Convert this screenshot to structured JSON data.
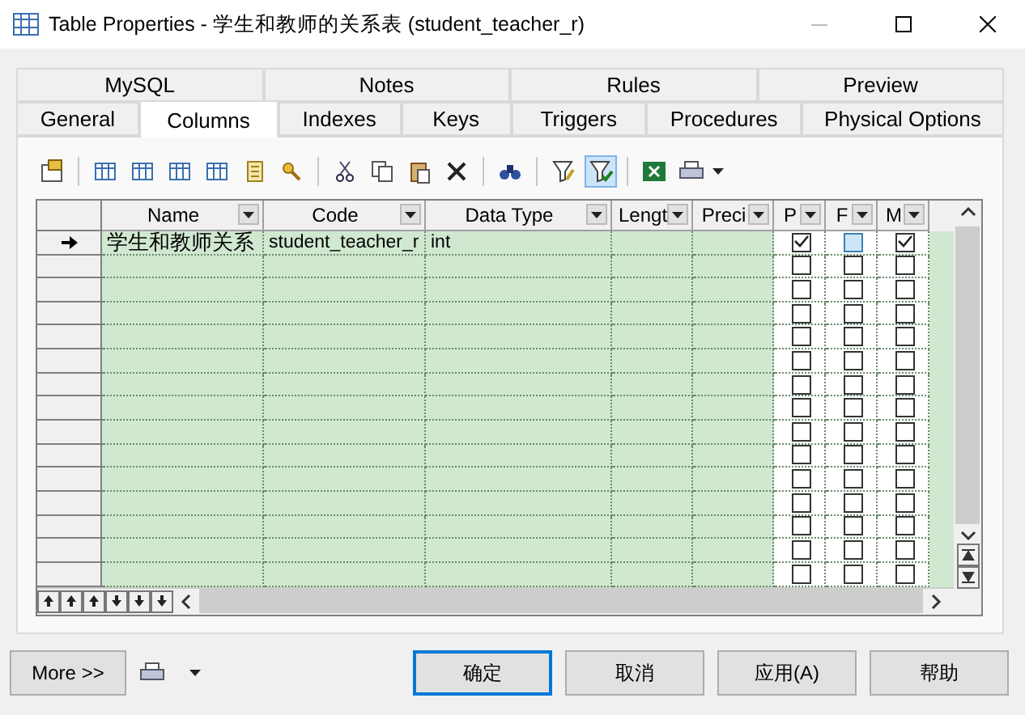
{
  "window": {
    "title": "Table Properties - 学生和教师的关系表 (student_teacher_r)"
  },
  "tab_rows": [
    [
      {
        "label": "MySQL",
        "selected": false
      },
      {
        "label": "Notes",
        "selected": false
      },
      {
        "label": "Rules",
        "selected": false
      },
      {
        "label": "Preview",
        "selected": false
      }
    ],
    [
      {
        "label": "General",
        "selected": false
      },
      {
        "label": "Columns",
        "selected": true
      },
      {
        "label": "Indexes",
        "selected": false
      },
      {
        "label": "Keys",
        "selected": false
      },
      {
        "label": "Triggers",
        "selected": false
      },
      {
        "label": "Procedures",
        "selected": false
      },
      {
        "label": "Physical Options",
        "selected": false
      }
    ]
  ],
  "toolbar": {
    "filter_pressed": true
  },
  "table": {
    "columns": [
      "Name",
      "Code",
      "Data Type",
      "Lengt",
      "Preci",
      "P",
      "F",
      "M"
    ],
    "rows": [
      {
        "current": true,
        "name": "学生和教师关系",
        "code": "student_teacher_r",
        "data_type": "int",
        "checks": [
          {
            "checked": true,
            "focused": false
          },
          {
            "checked": false,
            "focused": true
          },
          {
            "checked": true,
            "focused": false
          }
        ]
      },
      {
        "current": false,
        "checks": [
          {
            "checked": false,
            "focused": false
          },
          {
            "checked": false,
            "focused": false
          },
          {
            "checked": false,
            "focused": false
          }
        ]
      },
      {
        "current": false,
        "checks": [
          {
            "checked": false,
            "focused": false
          },
          {
            "checked": false,
            "focused": false
          },
          {
            "checked": false,
            "focused": false
          }
        ]
      },
      {
        "current": false,
        "checks": [
          {
            "checked": false,
            "focused": false
          },
          {
            "checked": false,
            "focused": false
          },
          {
            "checked": false,
            "focused": false
          }
        ]
      },
      {
        "current": false,
        "checks": [
          {
            "checked": false,
            "focused": false
          },
          {
            "checked": false,
            "focused": false
          },
          {
            "checked": false,
            "focused": false
          }
        ]
      },
      {
        "current": false,
        "checks": [
          {
            "checked": false,
            "focused": false
          },
          {
            "checked": false,
            "focused": false
          },
          {
            "checked": false,
            "focused": false
          }
        ]
      },
      {
        "current": false,
        "checks": [
          {
            "checked": false,
            "focused": false
          },
          {
            "checked": false,
            "focused": false
          },
          {
            "checked": false,
            "focused": false
          }
        ]
      },
      {
        "current": false,
        "checks": [
          {
            "checked": false,
            "focused": false
          },
          {
            "checked": false,
            "focused": false
          },
          {
            "checked": false,
            "focused": false
          }
        ]
      },
      {
        "current": false,
        "checks": [
          {
            "checked": false,
            "focused": false
          },
          {
            "checked": false,
            "focused": false
          },
          {
            "checked": false,
            "focused": false
          }
        ]
      },
      {
        "current": false,
        "checks": [
          {
            "checked": false,
            "focused": false
          },
          {
            "checked": false,
            "focused": false
          },
          {
            "checked": false,
            "focused": false
          }
        ]
      },
      {
        "current": false,
        "checks": [
          {
            "checked": false,
            "focused": false
          },
          {
            "checked": false,
            "focused": false
          },
          {
            "checked": false,
            "focused": false
          }
        ]
      },
      {
        "current": false,
        "checks": [
          {
            "checked": false,
            "focused": false
          },
          {
            "checked": false,
            "focused": false
          },
          {
            "checked": false,
            "focused": false
          }
        ]
      },
      {
        "current": false,
        "checks": [
          {
            "checked": false,
            "focused": false
          },
          {
            "checked": false,
            "focused": false
          },
          {
            "checked": false,
            "focused": false
          }
        ]
      },
      {
        "current": false,
        "checks": [
          {
            "checked": false,
            "focused": false
          },
          {
            "checked": false,
            "focused": false
          },
          {
            "checked": false,
            "focused": false
          }
        ]
      },
      {
        "current": false,
        "checks": [
          {
            "checked": false,
            "focused": false
          },
          {
            "checked": false,
            "focused": false
          },
          {
            "checked": false,
            "focused": false
          }
        ]
      }
    ]
  },
  "buttons": [
    {
      "label": "More >>",
      "default": false
    },
    {
      "label": "确定",
      "default": true
    },
    {
      "label": "取消",
      "default": false
    },
    {
      "label": "应用(A)",
      "default": false
    },
    {
      "label": "帮助",
      "default": false
    }
  ]
}
